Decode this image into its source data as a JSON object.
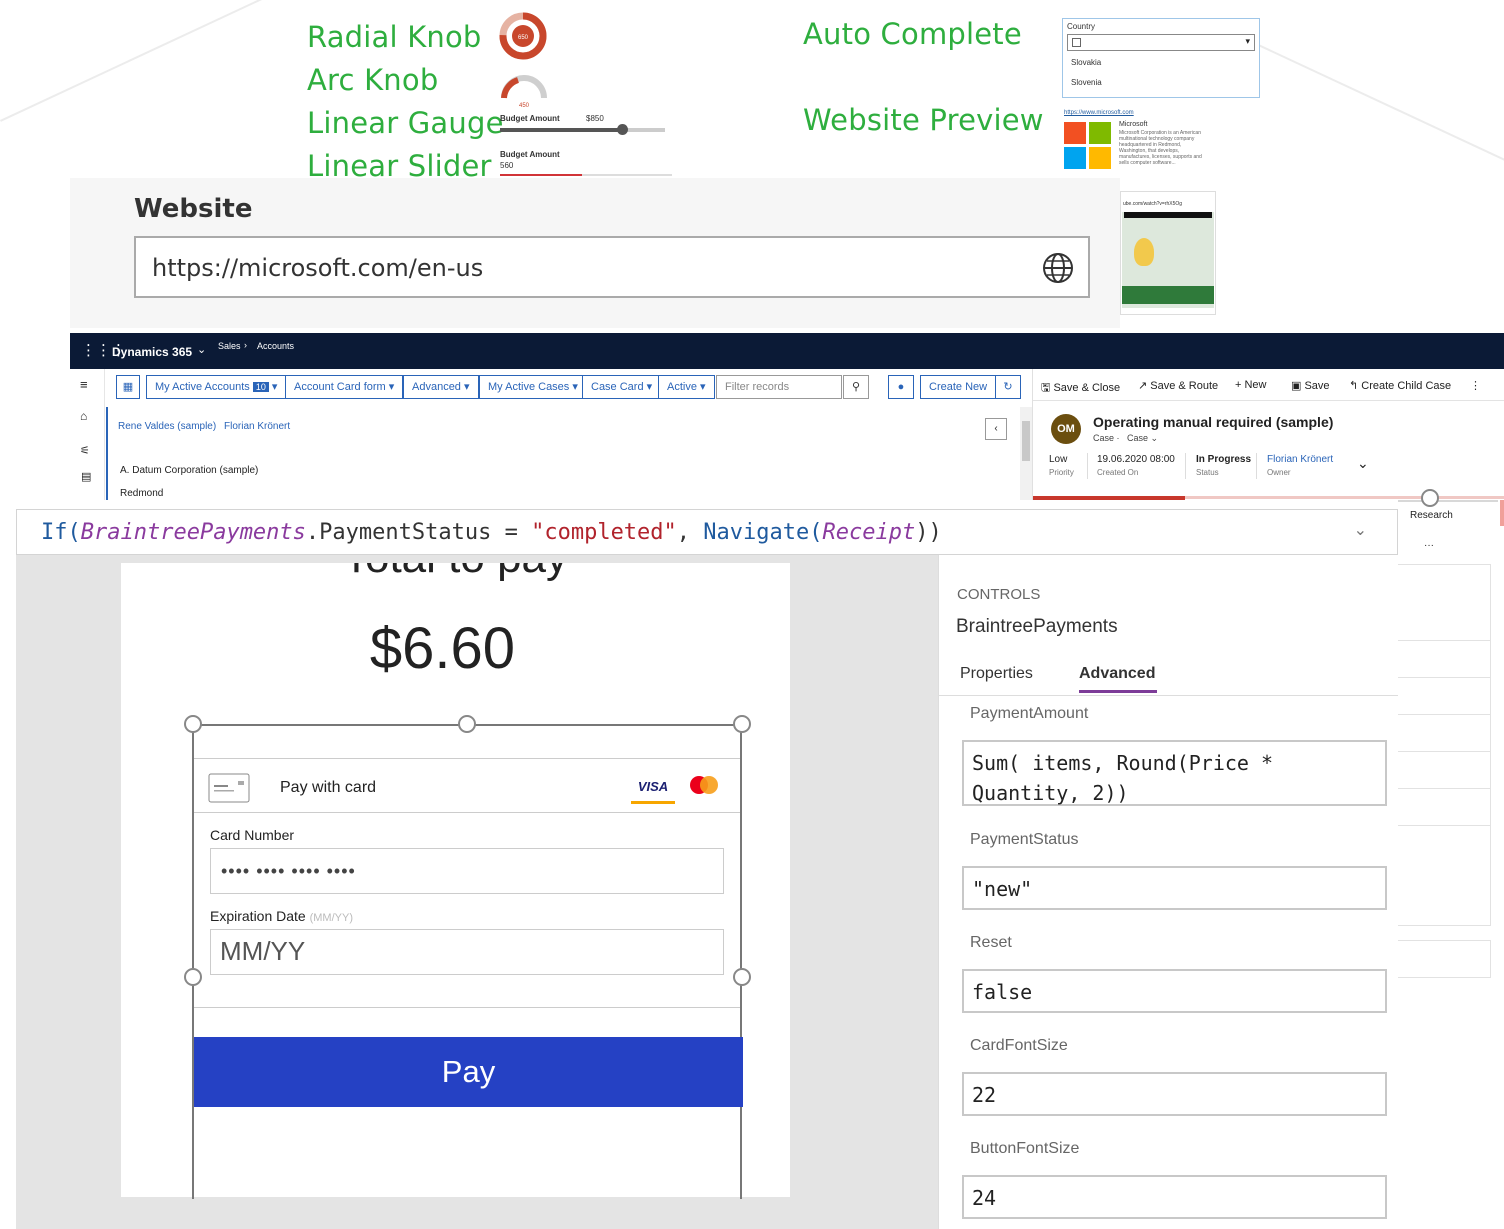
{
  "gallery": {
    "features_left": [
      "Radial Knob",
      "Arc Knob",
      "Linear Gauge",
      "Linear Slider"
    ],
    "features_right": [
      "Auto Complete",
      "Website Preview"
    ],
    "knob_value": "650",
    "arc_value": "450",
    "gauge_label": "Budget Amount",
    "gauge_value": "$850",
    "gauge_fill": 0.74,
    "slider_label": "Budget Amount",
    "slider_value": "560",
    "autocomplete": {
      "label": "Country",
      "options": [
        "Slovakia",
        "Slovenia"
      ]
    },
    "preview": {
      "url": "https://www.microsoft.com",
      "title": "Microsoft",
      "description": "Microsoft Corporation is an American multinational technology company headquartered in Redmond, Washington, that develops, manufactures, licenses, supports and sells computer software...",
      "video_url": "ube.com/watch?v=rhX5Og",
      "colors": [
        "#f25022",
        "#7fba00",
        "#00a4ef",
        "#ffb900"
      ]
    }
  },
  "website": {
    "label": "Website",
    "value": "https://microsoft.com/en-us",
    "icon": "globe-icon"
  },
  "dynamics": {
    "app_name": "Dynamics 365",
    "breadcrumb": [
      "Sales",
      "Accounts"
    ],
    "toolbar": {
      "view": "My Active Accounts",
      "view_count": "10",
      "card_form": "Account Card form",
      "advanced": "Advanced",
      "cases": "My Active Cases",
      "case_card": "Case Card",
      "status": "Active",
      "filter_placeholder": "Filter records",
      "create_new": "Create New"
    },
    "people": [
      "Rene Valdes (sample)",
      "Florian Krönert"
    ],
    "account_name": "A. Datum Corporation (sample)",
    "account_city": "Redmond",
    "commands": {
      "save_close": "Save & Close",
      "save_route": "Save & Route",
      "new": "New",
      "save": "Save",
      "create_child": "Create Child Case"
    },
    "case": {
      "initials": "OM",
      "title": "Operating manual required (sample)",
      "subtitle_entity": "Case",
      "subtitle_form": "Case",
      "priority": "Low",
      "priority_label": "Priority",
      "created_on": "19.06.2020 08:00",
      "created_on_label": "Created On",
      "status": "In Progress",
      "status_label": "Status",
      "owner": "Florian Krönert",
      "owner_label": "Owner",
      "stage": "Research"
    }
  },
  "formula": {
    "fn1": "If(",
    "obj1": "BraintreePayments",
    "rest1": ".PaymentStatus = ",
    "str1": "\"completed\"",
    "sep": ", ",
    "fn2": "Navigate(",
    "obj2": "Receipt",
    "end": "))"
  },
  "app": {
    "total_label": "Total to pay",
    "total": "$6.60",
    "pay_with_card": "Pay with card",
    "card_number_label": "Card Number",
    "card_number_value": "•••• •••• •••• ••••",
    "expiration_label": "Expiration Date",
    "expiration_hint": "(MM/YY)",
    "expiration_placeholder": "MM/YY",
    "pay_button": "Pay",
    "visa": "VISA"
  },
  "panel": {
    "section": "CONTROLS",
    "control_name": "BraintreePayments",
    "tabs": [
      "Properties",
      "Advanced"
    ],
    "active_tab": "Advanced",
    "properties": [
      {
        "name": "PaymentAmount",
        "value": "Sum( items, Round(Price * Quantity, 2))"
      },
      {
        "name": "PaymentStatus",
        "value": "\"new\""
      },
      {
        "name": "Reset",
        "value": "false"
      },
      {
        "name": "CardFontSize",
        "value": "22"
      },
      {
        "name": "ButtonFontSize",
        "value": "24"
      }
    ]
  },
  "colors": {
    "feature_green": "#2eae3e",
    "pay_button": "#2541c4",
    "d365_nav": "#0b1a36",
    "d365_link": "#2a64b8"
  }
}
